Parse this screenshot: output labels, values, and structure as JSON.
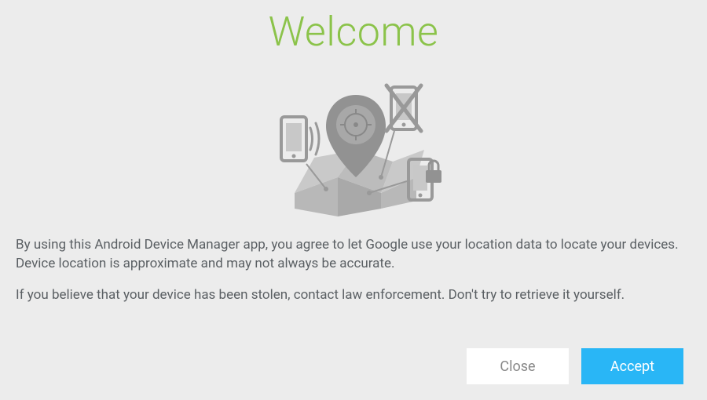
{
  "title": "Welcome",
  "paragraphs": {
    "p1": "By using this Android Device Manager app, you agree to let Google use your location data to locate your devices. Device location is approximate and may not always be accurate.",
    "p2": "If you believe that your device has been stolen, contact law enforcement. Don't try to retrieve it yourself."
  },
  "buttons": {
    "close": "Close",
    "accept": "Accept"
  }
}
